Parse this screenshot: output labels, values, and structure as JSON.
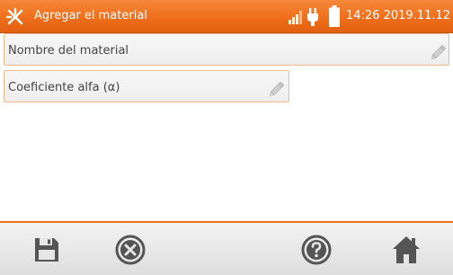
{
  "header": {
    "title": "Agregar el material",
    "datetime": "14:26 2019.11.12",
    "icons": {
      "app": "tools-icon",
      "signal": "signal-icon",
      "power": "plug-icon",
      "battery": "battery-icon"
    }
  },
  "form": {
    "material_name": {
      "label": "Nombre del material",
      "value": "",
      "icon": "pencil-icon"
    },
    "alpha_coefficient": {
      "label": "Coeficiente alfa (α)",
      "value": "",
      "icon": "pencil-icon"
    }
  },
  "toolbar": {
    "buttons": [
      "save-icon",
      "cancel-icon",
      "help-icon",
      "home-icon"
    ]
  },
  "colors": {
    "accent": "#ef6f1c",
    "field_border": "#f0b88a",
    "toolbar_icon": "#555555"
  }
}
